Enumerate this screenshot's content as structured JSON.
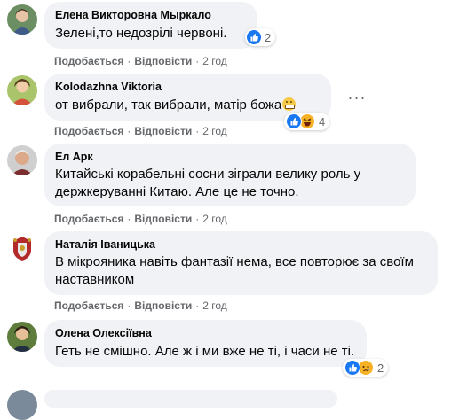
{
  "comments": [
    {
      "author": "Елена Викторовна Мыркало",
      "text": "Зелені,то недозрілі червоні.",
      "reaction_count": "2",
      "like_label": "Подобається",
      "reply_label": "Відповісти",
      "time": "2 год"
    },
    {
      "author": "Kolodazhna Viktoria",
      "text": "от вибрали, так вибрали, матір божа",
      "reaction_count": "4",
      "like_label": "Подобається",
      "reply_label": "Відповісти",
      "time": "2 год",
      "more_icon": "more-options-icon"
    },
    {
      "author": "Ел Арк",
      "text": "Китайські корабельні сосни зіграли велику роль у держкеруванні Китаю. Але це не точно.",
      "like_label": "Подобається",
      "reply_label": "Відповісти",
      "time": "2 год"
    },
    {
      "author": "Наталія Іваницька",
      "text": "В мікрояника навіть фантазії нема, все повторює за своїм наставником",
      "like_label": "Подобається",
      "reply_label": "Відповісти",
      "time": "2 год"
    },
    {
      "author": "Олена Олексіївна",
      "text": "Геть не смішно. Але ж і ми вже не ті, і часи не ті.",
      "reaction_count": "2",
      "like_label": "Подобається",
      "reply_label": "Відповісти",
      "time": "2 год"
    }
  ],
  "colors": {
    "bubble": "#f0f2f5",
    "meta": "#65676b",
    "like_blue": "#1877f2",
    "haha_yellow": "#f7b125"
  }
}
